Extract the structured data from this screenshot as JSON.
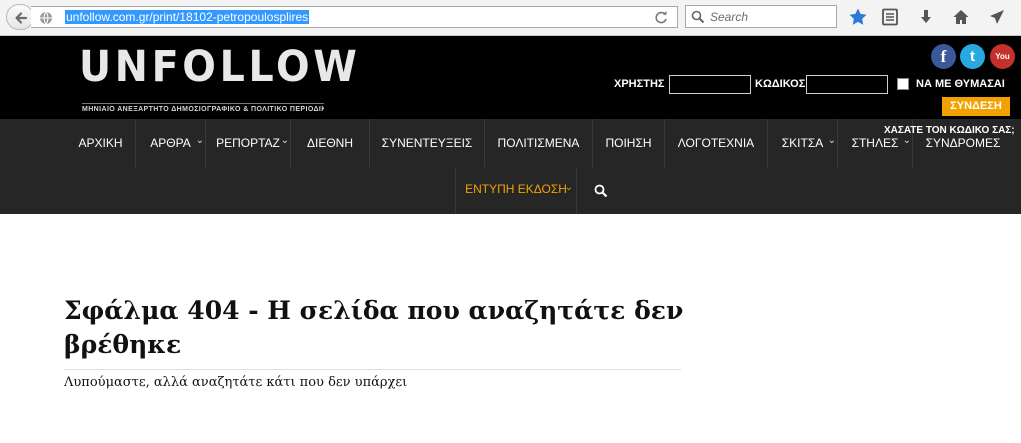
{
  "browser": {
    "url": "unfollow.com.gr/print/18102-petropoulosplires",
    "search_placeholder": "Search"
  },
  "header": {
    "logo": "UNFOLLOW",
    "tagline": "ΜΗΝΙΑΙΟ ΑΝΕΞΑΡΤΗΤΟ ΔΗΜΟΣΙΟΓΡΑΦΙΚΟ & ΠΟΛΙΤΙΚΟ ΠΕΡΙΟΔΙΚΟ",
    "social": {
      "facebook": "f",
      "twitter": "t",
      "youtube": "You"
    },
    "login": {
      "user_label": "ΧΡΗΣΤΗΣ",
      "password_label": "ΚΩΔΙΚΟΣ",
      "remember_label": "ΝΑ ΜΕ ΘΥΜΑΣΑΙ",
      "submit_label": "ΣΥΝΔΕΣΗ",
      "forgot_label": "ΧΑΣΑΤΕ ΤΟΝ ΚΩΔΙΚΟ ΣΑΣ;"
    }
  },
  "nav": {
    "items": [
      {
        "label": "ΑΡΧΙΚΗ"
      },
      {
        "label": "ΑΡΘΡΑ"
      },
      {
        "label": "ΡΕΠΟΡΤΑΖ"
      },
      {
        "label": "ΔΙΕΘΝΗ"
      },
      {
        "label": "ΣΥΝΕΝΤΕΥΞΕΙΣ"
      },
      {
        "label": "ΠΟΛΙΤΙΣΜΕΝΑ"
      },
      {
        "label": "ΠΟΙΗΣΗ"
      },
      {
        "label": "ΛΟΓΟΤΕΧΝΙΑ"
      },
      {
        "label": "ΣΚΙΤΣΑ"
      },
      {
        "label": "ΣΤΗΛΕΣ"
      },
      {
        "label": "ΣΥΝΔΡΟΜΕΣ"
      }
    ],
    "print_label": "ΕΝΤΥΠΗ ΕΚΔΟΣΗ"
  },
  "content": {
    "title": "Σφάλμα 404 - Η σελίδα που αναζητάτε δεν βρέθηκε",
    "description": "Λυπούμαστε, αλλά αναζητάτε κάτι που δεν υπάρχει"
  },
  "colors": {
    "accent": "#f2a100",
    "nav_bg": "#262626",
    "header_bg": "#000000"
  }
}
